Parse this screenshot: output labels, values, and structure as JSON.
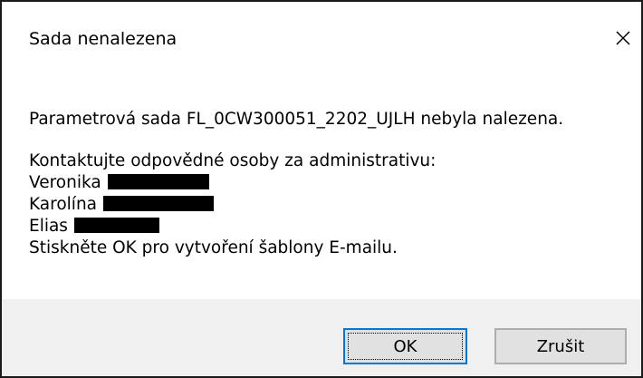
{
  "dialog": {
    "title": "Sada nenalezena",
    "close_icon": "close-icon"
  },
  "message": {
    "line1": "Parametrová sada FL_0CW300051_2202_UJLH nebyla nalezena.",
    "contact_heading": "Kontaktujte odpovědné osoby za administrativu:",
    "contacts": [
      "Veronika",
      "Karolína",
      "Elias"
    ],
    "instruction": "Stiskněte OK pro vytvoření šablony E-mailu."
  },
  "buttons": {
    "ok_label": "OK",
    "cancel_label": "Zrušit"
  },
  "colors": {
    "footer_bg": "#f0f0f0",
    "button_bg": "#e1e1e1",
    "default_button_border": "#0078d7",
    "redaction": "#000000"
  }
}
